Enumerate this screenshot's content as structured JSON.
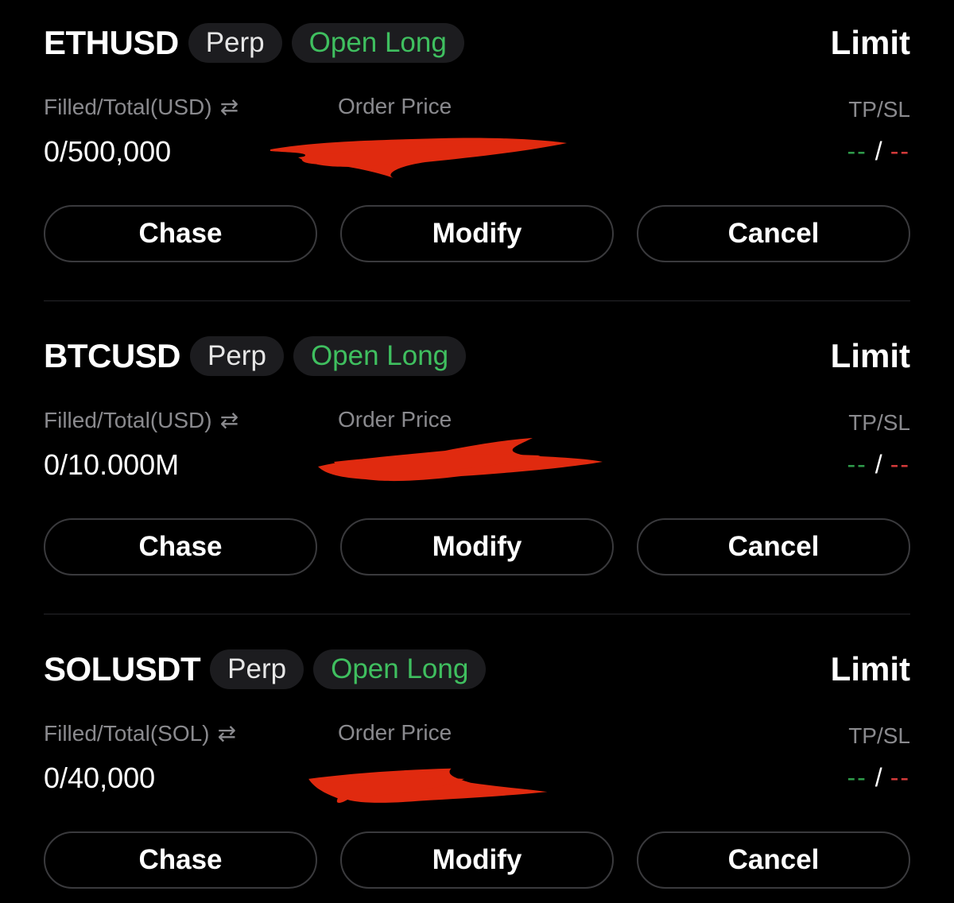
{
  "orders": [
    {
      "symbol": "ETHUSD",
      "market_type": "Perp",
      "side": "Open Long",
      "order_type": "Limit",
      "filled_label": "Filled/Total(USD)",
      "filled_value": "0/500,000",
      "price_label": "Order Price",
      "tpsl_label": "TP/SL",
      "tp_value": "--",
      "tpsl_separator": "/",
      "sl_value": "--",
      "buttons": {
        "chase": "Chase",
        "modify": "Modify",
        "cancel": "Cancel"
      }
    },
    {
      "symbol": "BTCUSD",
      "market_type": "Perp",
      "side": "Open Long",
      "order_type": "Limit",
      "filled_label": "Filled/Total(USD)",
      "filled_value": "0/10.000M",
      "price_label": "Order Price",
      "tpsl_label": "TP/SL",
      "tp_value": "--",
      "tpsl_separator": "/",
      "sl_value": "--",
      "buttons": {
        "chase": "Chase",
        "modify": "Modify",
        "cancel": "Cancel"
      }
    },
    {
      "symbol": "SOLUSDT",
      "market_type": "Perp",
      "side": "Open Long",
      "order_type": "Limit",
      "filled_label": "Filled/Total(SOL)",
      "filled_value": "0/40,000",
      "price_label": "Order Price",
      "tpsl_label": "TP/SL",
      "tp_value": "--",
      "tpsl_separator": "/",
      "sl_value": "--",
      "buttons": {
        "chase": "Chase",
        "modify": "Modify",
        "cancel": "Cancel"
      }
    }
  ],
  "icons": {
    "swap": "swap-arrows-icon"
  },
  "colors": {
    "background": "#000000",
    "long": "#3fbf5f",
    "tp": "#2e9b4a",
    "sl": "#d23a3a",
    "redaction": "#e02a0f",
    "muted_text": "#8a8a8e"
  }
}
